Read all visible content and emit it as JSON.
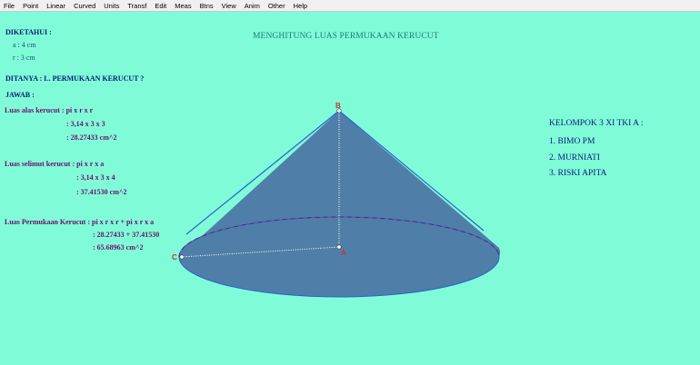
{
  "menu": [
    "File",
    "Point",
    "Linear",
    "Curved",
    "Units",
    "Transf",
    "Edit",
    "Meas",
    "Btns",
    "View",
    "Anim",
    "Other",
    "Help"
  ],
  "title": "MENGHITUNG LUAS PERMUKAAN KERUCUT",
  "diketahui": {
    "heading": "DIKETAHUI :",
    "a": "a : 4 cm",
    "r": "r : 3 cm"
  },
  "ditanya": "DITANYA : L. PERMUKAAN KERUCUT ?",
  "jawab": "JAWAB :",
  "alas": {
    "label": "Luas alas kerucut : pi x r x r",
    "step1": ": 3,14 x 3 x 3",
    "result": ": 28.27433  cm^2"
  },
  "selimut": {
    "label": "Luas selimut kerucut : pi x r x a",
    "step1": ": 3,14 x 3 x 4",
    "result": ": 37.41530  cm^2"
  },
  "permukaan": {
    "label": "Luas Permukaan Kerucut : pi x r x r + pi x r x a",
    "step1": ": 28.27433  + 37.41530",
    "result": ": 65.68963  cm^2"
  },
  "kelompok": {
    "heading": "KELOMPOK 3 XI TKI A :",
    "members": [
      "1. BIMO PM",
      "2. MURNIATI",
      "3. RISKI APITA"
    ]
  },
  "points": {
    "apex": "B",
    "center": "A",
    "edge": "C"
  },
  "colors": {
    "background": "#7ffcd7",
    "cone_fill": "#4f7fa8",
    "cone_edge": "#2d5fd0",
    "dashed": "#6a1f6a"
  }
}
